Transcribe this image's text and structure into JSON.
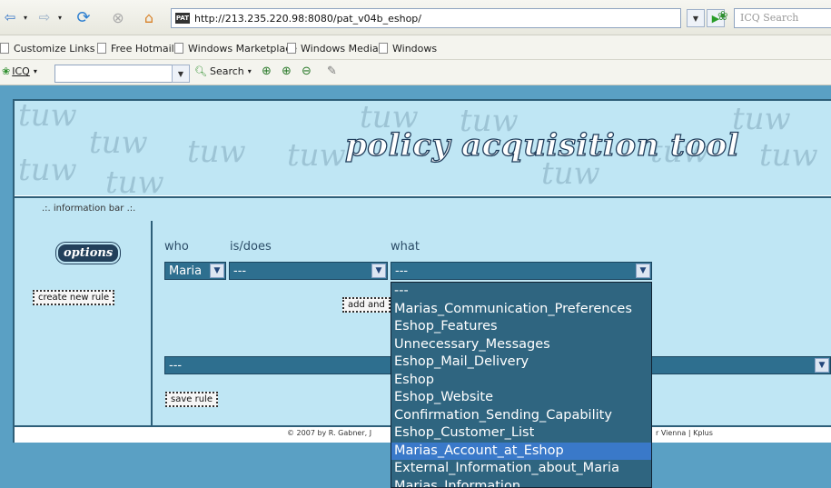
{
  "browser": {
    "address_url": "http://213.235.220.98:8080/pat_v04b_eshop/",
    "favicon_text": "PAT",
    "search_placeholder": "ICQ Search",
    "links": [
      "Customize Links",
      "Free Hotmail",
      "Windows Marketplace",
      "Windows Media",
      "Windows"
    ],
    "icq_label": "ICQ",
    "search_button": "Search"
  },
  "page": {
    "logo_text": "policy acquisition tool",
    "watermark_text": "tuw",
    "info_bar": ".:. information bar .:.",
    "options_label": "options",
    "create_rule_button": "create new rule",
    "add_button": "add and",
    "save_rule_button": "save rule",
    "col_who": "who",
    "col_isdoes": "is/does",
    "col_what": "what",
    "who_value": "Maria",
    "isdoes_value": "---",
    "what_value": "---",
    "second_row_value": "---",
    "footer_left": "© 2007 by R. Gabner, J",
    "footer_right": "r Vienna | Kplus"
  },
  "dropdown": {
    "options": [
      "---",
      "Marias_Communication_Preferences",
      "Eshop_Features",
      "Unnecessary_Messages",
      "Eshop_Mail_Delivery",
      "Eshop",
      "Eshop_Website",
      "Confirmation_Sending_Capability",
      "Eshop_Customer_List",
      "Marias_Account_at_Eshop",
      "External_Information_about_Maria",
      "Marias_Information"
    ],
    "selected": "Marias_Account_at_Eshop"
  }
}
